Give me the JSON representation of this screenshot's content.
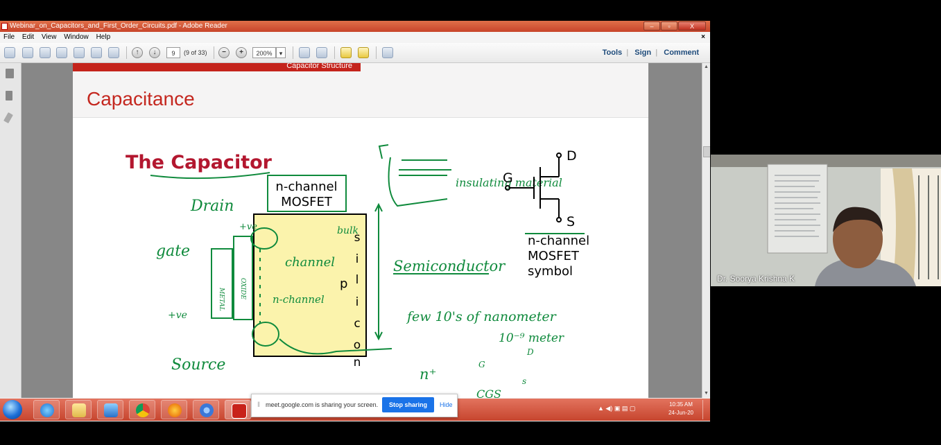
{
  "window": {
    "title": "Webinar_on_Capacitors_and_First_Order_Circuits.pdf - Adobe Reader",
    "buttons": [
      "–",
      "▫",
      "X"
    ]
  },
  "menu": {
    "items": [
      "File",
      "Edit",
      "View",
      "Window",
      "Help"
    ],
    "close": "×"
  },
  "toolbar": {
    "page_number": "9",
    "page_of": "(9 of 33)",
    "zoom": "200%",
    "tools_label": "Tools",
    "sign_label": "Sign",
    "comment_label": "Comment"
  },
  "slide": {
    "section_label": "Capacitor Structure",
    "title": "Capacitance",
    "heading": "The Capacitor",
    "box_label_1": "n-channel",
    "box_label_2": "MOSFET",
    "symbol_label_1": "n-channel",
    "symbol_label_2": "MOSFET",
    "symbol_label_3": "symbol",
    "terminal_d": "D",
    "terminal_g": "G",
    "terminal_s": "S",
    "silicon_letters": [
      "s",
      "i",
      "l",
      "i",
      "c",
      "o",
      "n"
    ],
    "p_label": "p",
    "hand_notes": {
      "drain": "Drain",
      "gate": "gate",
      "source": "Source",
      "bulk": "bulk",
      "channel": "channel",
      "n_channel": "n-channel",
      "semiconductor": "Semiconductor",
      "insulating": "insulating material",
      "plus_ve": "+ve",
      "size_note": "few 10's of nanometer",
      "exp_note": "10⁻⁹ meter",
      "n_plus": "n⁺",
      "cgs": "CGS",
      "oxide": "OXIDE",
      "metal": "METAL",
      "g_small": "G",
      "d_small": "D",
      "s_small": "s"
    }
  },
  "share_bar": {
    "message": "meet.google.com is sharing your screen.",
    "stop_label": "Stop sharing",
    "hide_label": "Hide"
  },
  "taskbar": {
    "time": "10:35 AM",
    "date": "24-Jun-20"
  },
  "video": {
    "participant": "Dr. Soorya Krishna K"
  },
  "colors": {
    "accent_red": "#c4271f",
    "ink_green": "#0f8a3c",
    "mosfet_fill": "#fbf3ac",
    "heading_red": "#b3172f",
    "share_blue": "#1a73e8"
  }
}
